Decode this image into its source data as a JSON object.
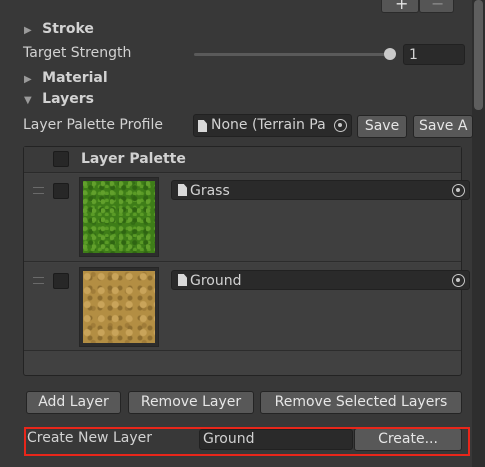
{
  "toolbar": {
    "plus": "+",
    "minus": "−"
  },
  "sections": {
    "stroke": "Stroke",
    "material": "Material",
    "layers": "Layers"
  },
  "target_strength": {
    "label": "Target Strength",
    "value": "1",
    "slider_level": 1.0
  },
  "palette_profile": {
    "label": "Layer Palette Profile",
    "value": "None (Terrain Pa",
    "save": "Save",
    "save_as": "Save A"
  },
  "layer_palette": {
    "header": "Layer Palette",
    "layers": [
      {
        "name": "Grass"
      },
      {
        "name": "Ground"
      }
    ]
  },
  "actions": {
    "add_layer": "Add Layer",
    "remove_layer": "Remove Layer",
    "remove_selected": "Remove Selected Layers"
  },
  "create_new": {
    "label": "Create New Layer",
    "value": "Ground",
    "button": "Create..."
  },
  "colors": {
    "highlight": "#e8261a",
    "background": "#383838"
  },
  "icons": [
    "foldout-triangle-icon",
    "document-icon",
    "object-picker-icon",
    "drag-handle-icon"
  ]
}
